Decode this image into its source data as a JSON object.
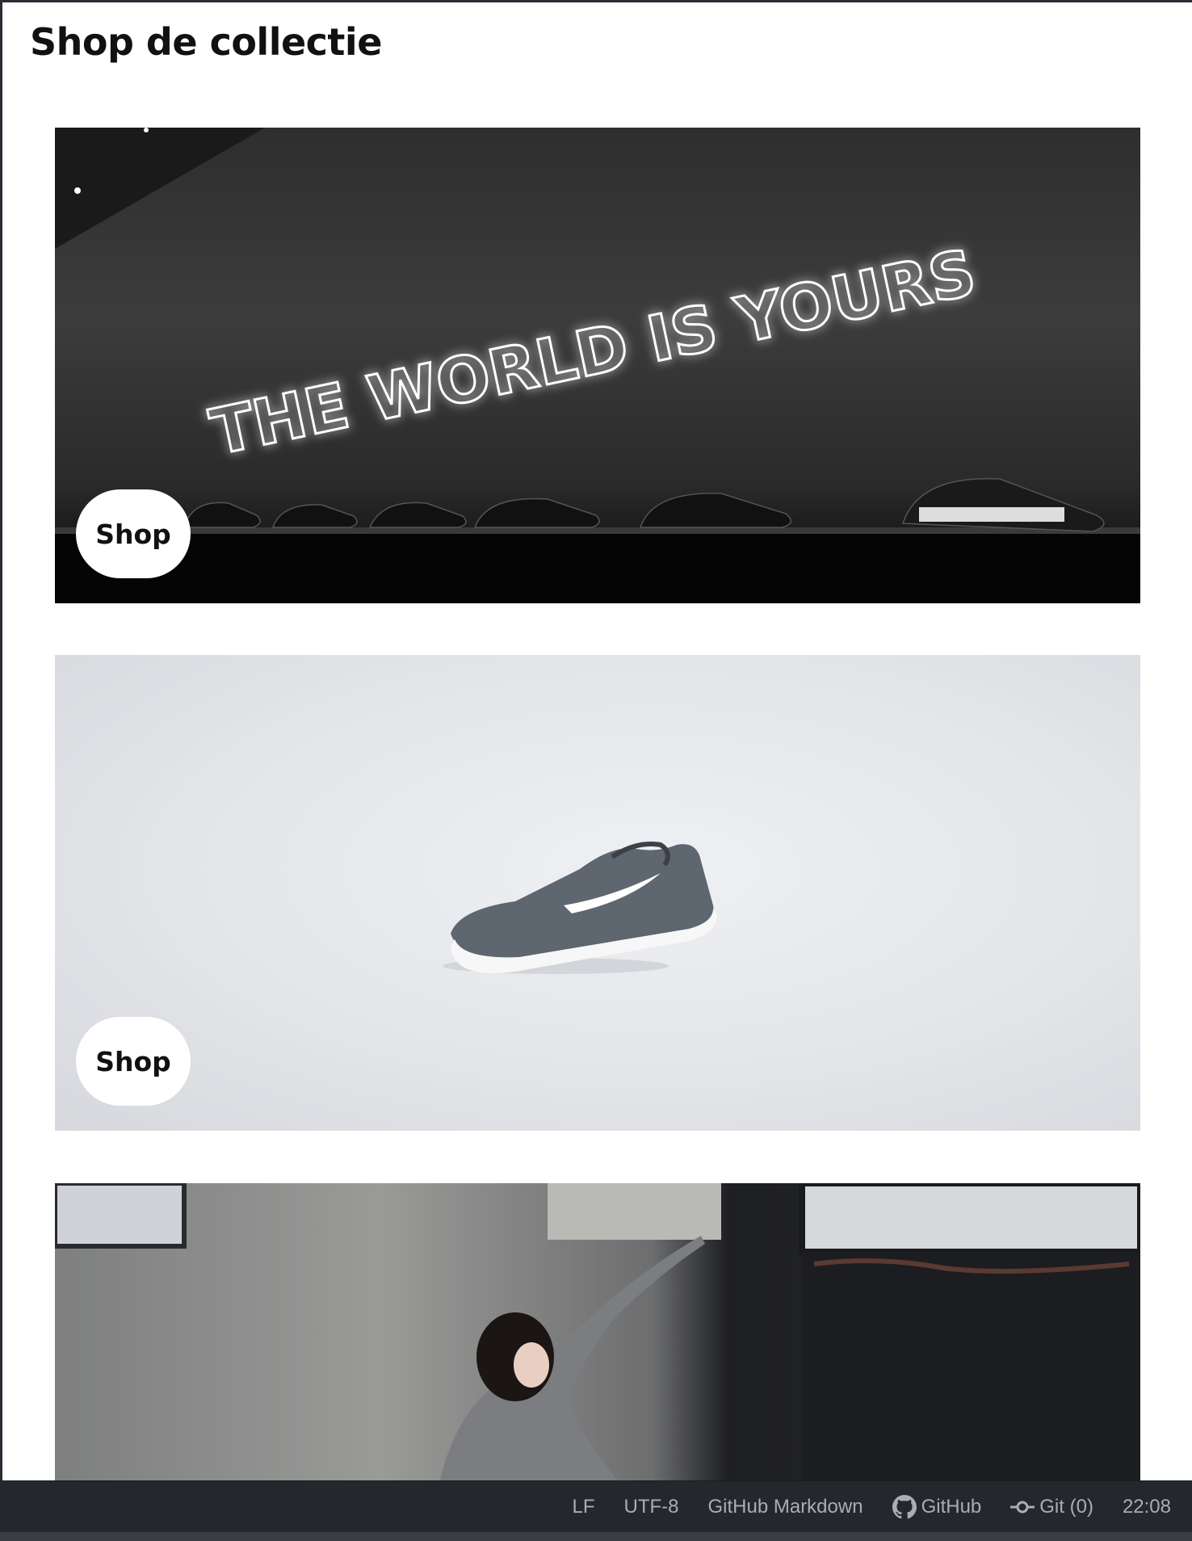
{
  "page": {
    "title": "Shop de collectie"
  },
  "cards": [
    {
      "button_label": "Shop",
      "image_alt": "THE WORLD IS YOURS"
    },
    {
      "button_label": "Shop"
    },
    {}
  ],
  "statusbar": {
    "line_ending": "LF",
    "encoding": "UTF-8",
    "grammar": "GitHub Markdown",
    "github": "GitHub",
    "git": "Git (0)",
    "clock": "22:08"
  }
}
